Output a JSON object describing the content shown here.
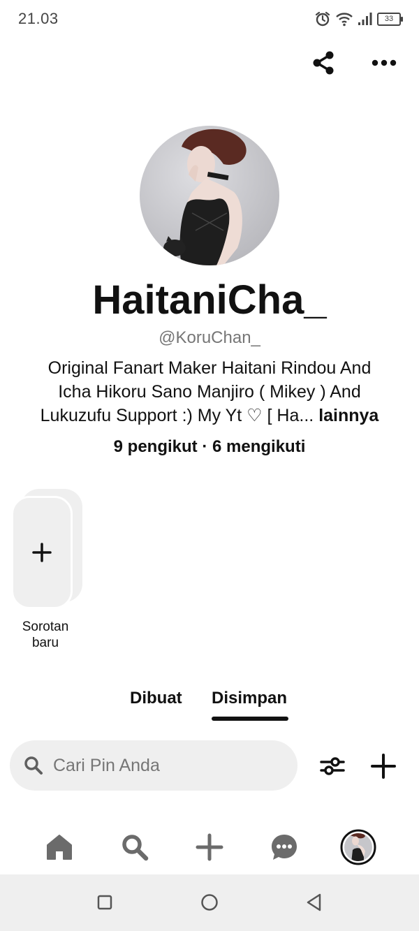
{
  "status_bar": {
    "time": "21.03",
    "battery": "33"
  },
  "profile": {
    "display_name": "HaitaniCha_",
    "username": "@KoruChan_",
    "bio_line1": "Original Fanart Maker   Haitani Rindou And",
    "bio_line2": "Icha Hikoru  Sano Manjiro ( Mikey ) And",
    "bio_line3": "Lukuzufu Support :) My Yt ♡ [ Ha...",
    "bio_more": "lainnya",
    "followers": "9 pengikut",
    "stats_separator": "·",
    "following": "6 mengikuti"
  },
  "highlight": {
    "label_line1": "Sorotan",
    "label_line2": "baru"
  },
  "tabs": [
    {
      "label": "Dibuat"
    },
    {
      "label": "Disimpan"
    }
  ],
  "active_tab": "Disimpan",
  "search": {
    "placeholder": "Cari Pin Anda"
  },
  "icons": {
    "share": "share-icon",
    "more": "more-dots-icon",
    "filter": "filter-icon",
    "add": "plus-icon",
    "home": "home-icon",
    "search": "search-icon",
    "create": "plus-icon",
    "messages": "message-icon",
    "profile": "avatar"
  },
  "colors": {
    "text": "#111111",
    "muted": "#767676",
    "field": "#efefef"
  }
}
